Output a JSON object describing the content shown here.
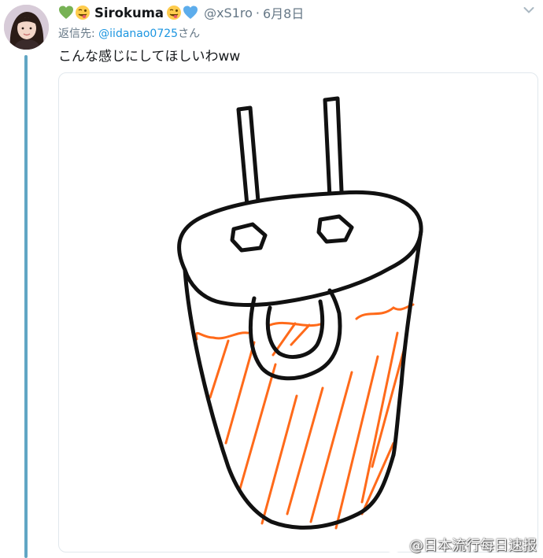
{
  "author": {
    "display_name": "Sirokuma",
    "handle": "@xS1ro",
    "separator": "·",
    "date": "6月8日",
    "name_emojis_before": [
      "green-heart-emoji",
      "winking-tongue-face-emoji"
    ],
    "name_emojis_after": [
      "winking-tongue-face-emoji",
      "blue-heart-emoji"
    ]
  },
  "reply": {
    "prefix": "返信先:",
    "mention": "@iidanao0725",
    "suffix": "さん"
  },
  "tweet": {
    "text": "こんな感じにしてほしいわww"
  },
  "media": {
    "description_icon": "drawing-of-cup-with-plug-prongs",
    "stroke_color": "#111111",
    "fill_color": "#ff6a1a"
  },
  "watermark": {
    "text": "@日本流行每日速报",
    "icon": "weibo-logo-icon"
  },
  "colors": {
    "thread_line": "#61a6c4",
    "mention": "#1b95e0",
    "secondary_text": "#657786"
  }
}
